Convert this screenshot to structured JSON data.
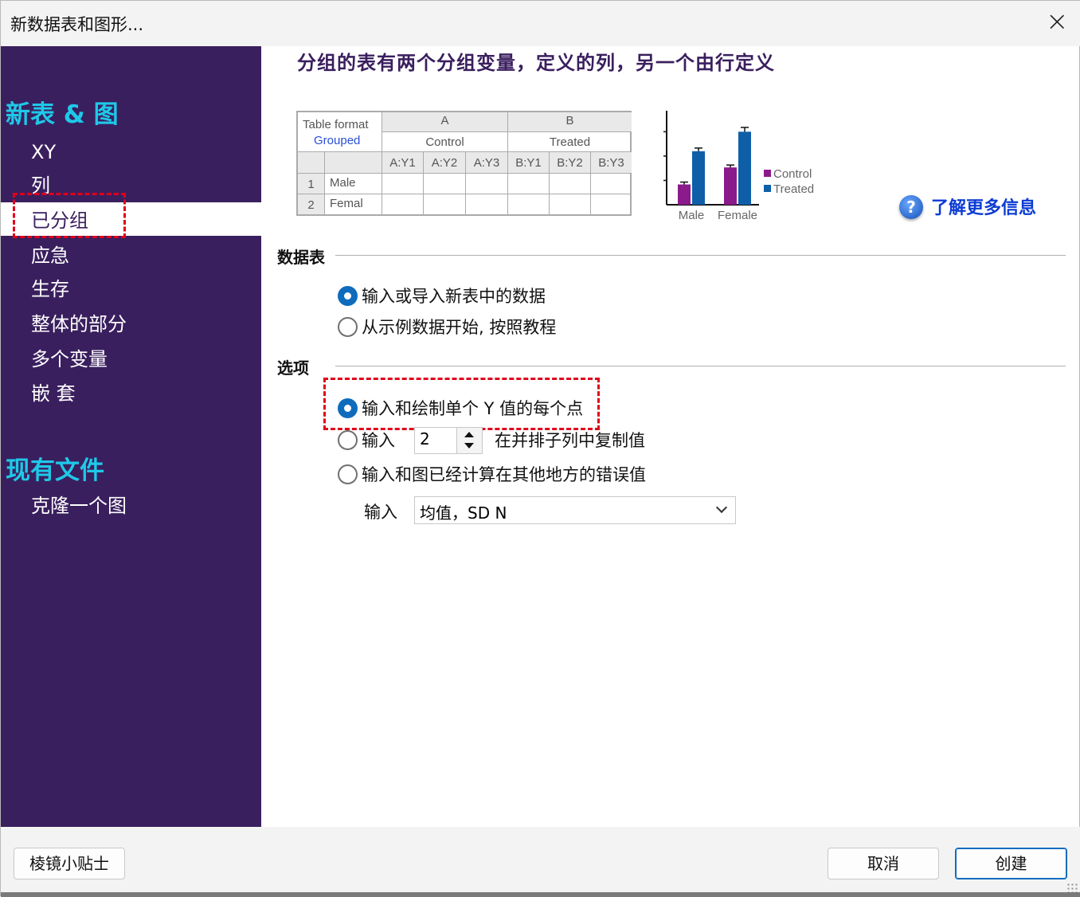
{
  "window": {
    "title": "新数据表和图形...",
    "close_icon": "×"
  },
  "sidebar": {
    "section_new": "新表 & 图",
    "items": [
      "XY",
      "列",
      "已分组",
      "应急",
      "生存",
      "整体的部分",
      "多个变量",
      "嵌 套"
    ],
    "selected_item": "已分组",
    "section_existing": "现有文件",
    "existing_items": [
      "克隆一个图"
    ]
  },
  "main": {
    "heading": "分组的表有两个分组变量，定义的列，另一个由行定义",
    "preview_table": {
      "corner_title": "Table format",
      "corner_subtitle": "Grouped",
      "group_a": "A",
      "group_b": "B",
      "group_a_name": "Control",
      "group_b_name": "Treated",
      "sub_columns": [
        "A:Y1",
        "A:Y2",
        "A:Y3",
        "B:Y1",
        "B:Y2",
        "B:Y3"
      ],
      "row_numbers": [
        "1",
        "2"
      ],
      "row_labels": [
        "Male",
        "Femal"
      ]
    },
    "help_link": "了解更多信息",
    "data_table_section": {
      "label": "数据表",
      "options": [
        "输入或导入新表中的数据",
        "从示例数据开始, 按照教程"
      ],
      "selected": 0
    },
    "options_section": {
      "label": "选项",
      "option_single": "输入和绘制单个 Y 值的每个点",
      "option_replicate_prefix": "输入",
      "replicate_count": "2",
      "option_replicate_suffix": "在并排子列中复制值",
      "option_error": "输入和图已经计算在其他地方的错误值",
      "error_input_label": "输入",
      "error_format": "均值，SD N",
      "selected": 0
    }
  },
  "footer": {
    "tips_button": "棱镜小贴士",
    "cancel_button": "取消",
    "create_button": "创建"
  },
  "colors": {
    "sidebar_bg": "#3a1f5e",
    "sidebar_heading": "#1fc8e8",
    "control": "#8b1a8b",
    "treated": "#0f5fa8",
    "highlight": "#e0001b"
  },
  "chart_data": {
    "type": "bar",
    "categories": [
      "Male",
      "Female"
    ],
    "series": [
      {
        "name": "Control",
        "values": [
          25,
          46
        ]
      },
      {
        "name": "Treated",
        "values": [
          66,
          90
        ]
      }
    ],
    "ylim": [
      0,
      110
    ],
    "legend": "right",
    "error_bars": true
  }
}
